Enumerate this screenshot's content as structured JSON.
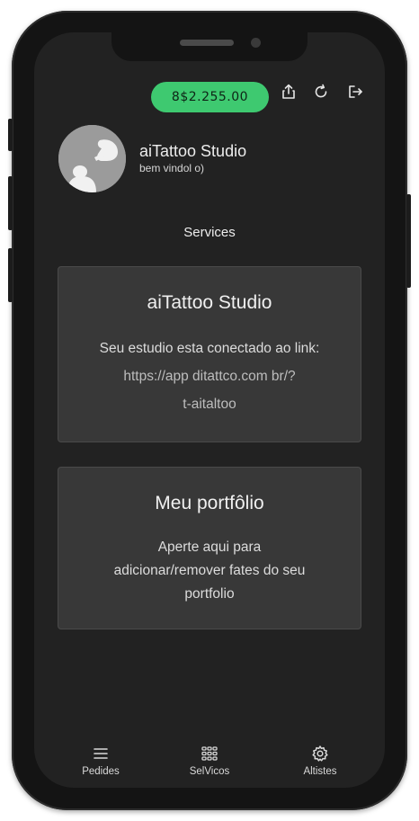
{
  "header": {
    "balance": "8$2.255.00"
  },
  "profile": {
    "name": "aiTattoo Studio",
    "greeting": "bem vindol o)"
  },
  "services": {
    "title": "Services"
  },
  "cards": {
    "studio": {
      "title": "aiTattoo Studio",
      "line1": "Seu estudio esta conectado ao link:",
      "line2": "https://app ditattco.com br/?",
      "line3": "t-aitaltoo"
    },
    "portfolio": {
      "title": "Meu portfôlio",
      "line1": "Aperte aqui para",
      "line2": "adicionar/remover fates  do seu",
      "line3": "portfolio"
    }
  },
  "tabs": [
    {
      "label": "Pedides",
      "icon": "menu-icon"
    },
    {
      "label": "SelVicos",
      "icon": "grid-icon"
    },
    {
      "label": "Altistes",
      "icon": "gear-icon"
    }
  ],
  "colors": {
    "accent": "#3ec970",
    "screen": "#222222",
    "card": "#383838"
  }
}
